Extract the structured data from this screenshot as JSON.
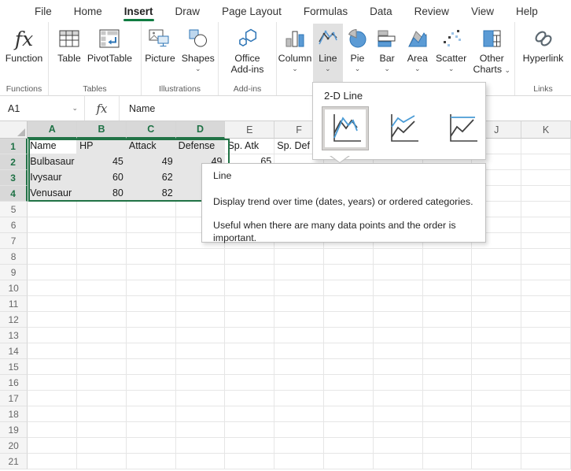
{
  "menu": {
    "tabs": [
      {
        "label": "File"
      },
      {
        "label": "Home"
      },
      {
        "label": "Insert"
      },
      {
        "label": "Draw"
      },
      {
        "label": "Page Layout"
      },
      {
        "label": "Formulas"
      },
      {
        "label": "Data"
      },
      {
        "label": "Review"
      },
      {
        "label": "View"
      },
      {
        "label": "Help"
      }
    ],
    "active_tab": "Insert"
  },
  "icons": {
    "chevron_down": "⌄",
    "fx_glyph": "fx"
  },
  "ribbon": {
    "buttons": {
      "function": "Function",
      "table": "Table",
      "pivottable": "PivotTable",
      "picture": "Picture",
      "shapes": "Shapes",
      "office_addins": "Office Add-ins",
      "column": "Column",
      "line": "Line",
      "pie": "Pie",
      "bar": "Bar",
      "area": "Area",
      "scatter": "Scatter",
      "other_charts": "Other Charts",
      "hyperlink": "Hyperlink"
    },
    "groups": {
      "functions": "Functions",
      "tables": "Tables",
      "illustrations": "Illustrations",
      "addins": "Add-ins",
      "links": "Links"
    },
    "active_button": "Line"
  },
  "formula_bar": {
    "name_box": "A1",
    "value": "Name"
  },
  "sheet": {
    "columns": [
      "A",
      "B",
      "C",
      "D",
      "E",
      "F",
      "G",
      "H",
      "I",
      "J",
      "K"
    ],
    "selected_columns": [
      "A",
      "B",
      "C",
      "D"
    ],
    "selection": {
      "range": "A1:D4",
      "active_cell": "A1"
    },
    "rows": [
      {
        "n": 1,
        "cells": {
          "A": "Name",
          "B": "HP",
          "C": "Attack",
          "D": "Defense",
          "E": "Sp. Atk",
          "F": "Sp. Def"
        }
      },
      {
        "n": 2,
        "cells": {
          "A": "Bulbasaur",
          "B": "45",
          "C": "49",
          "D": "49",
          "E": "65"
        }
      },
      {
        "n": 3,
        "cells": {
          "A": "Ivysaur",
          "B": "60",
          "C": "62"
        }
      },
      {
        "n": 4,
        "cells": {
          "A": "Venusaur",
          "B": "80",
          "C": "82"
        }
      }
    ],
    "visible_row_count": 21
  },
  "chart_menu": {
    "title": "2-D Line",
    "items": [
      {
        "icon": "line-chart-icon",
        "selected": true
      },
      {
        "icon": "stacked-line-chart-icon",
        "selected": false
      },
      {
        "icon": "100-percent-stacked-line-chart-icon",
        "selected": false
      }
    ]
  },
  "tooltip": {
    "title": "Line",
    "body1": "Display trend over time (dates, years) or ordered categories.",
    "body2": "Useful when there are many data points and the order is important."
  },
  "colors": {
    "accent_green": "#217346",
    "tab_underline": "#107C41",
    "chart_blue": "#5B9BD5",
    "chart_blue_outline": "#2E75B6",
    "icon_dark": "#404040",
    "icon_gray": "#BFBFBF",
    "selection_fill": "#E6E6E6",
    "selected_header_bg": "#D8D8D8"
  }
}
